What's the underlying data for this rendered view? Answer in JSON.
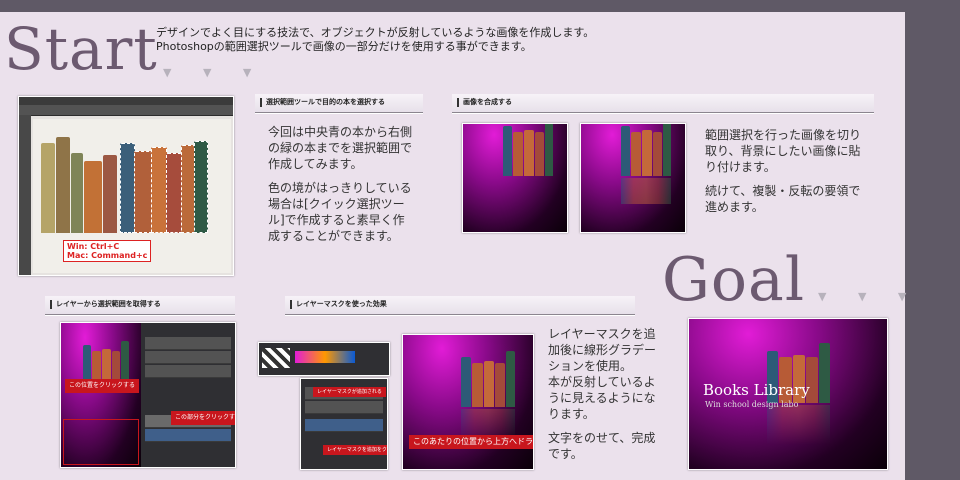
{
  "start": {
    "title": "Start",
    "intro_line1": "デザインでよく目にする技法で、オブジェクトが反射しているような画像を作成します。",
    "intro_line2": "Photoshopの範囲選択ツールで画像の一部分だけを使用する事ができます。"
  },
  "goal": {
    "title": "Goal"
  },
  "triangles": "▼ ▼ ▼",
  "steps": {
    "select": {
      "heading": "選択範囲ツールで目的の本を選択する",
      "p1": "今回は中央青の本から右側の緑の本までを選択範囲で作成してみます。",
      "p2": "色の境がはっきりしている場合は[クイック選択ツール]で作成すると素早く作成することができます。",
      "shortcut_win": "Win: Ctrl+C",
      "shortcut_mac": "Mac: Command+c"
    },
    "combine": {
      "heading": "画像を合成する",
      "p1": "範囲選択を行った画像を切り取り、背景にしたい画像に貼り付けます。",
      "p2": "続けて、複製・反転の要領で進めます。"
    },
    "layer_select": {
      "heading": "レイヤーから選択範囲を取得する",
      "note1": "この位置をクリックする",
      "note2": "この部分をクリックする"
    },
    "mask": {
      "heading": "レイヤーマスクを使った効果",
      "p1": "レイヤーマスクを追加後に線形グラデーションを使用。",
      "p2": "本が反射しているように見えるようになります。",
      "p3": "文字をのせて、完成です。",
      "drag_note": "このあたりの位置から上方へドラッグ",
      "note_a": "レイヤーマスクが追加される",
      "note_b": "レイヤーマスクを追加をクリック"
    }
  },
  "final_image": {
    "title": "Books Library",
    "subtitle": "Win school design labo"
  },
  "colors": {
    "accent": "#6c5a70",
    "background": "#ebe1ec",
    "frame": "#5f5966",
    "highlight": "#c8161d"
  }
}
